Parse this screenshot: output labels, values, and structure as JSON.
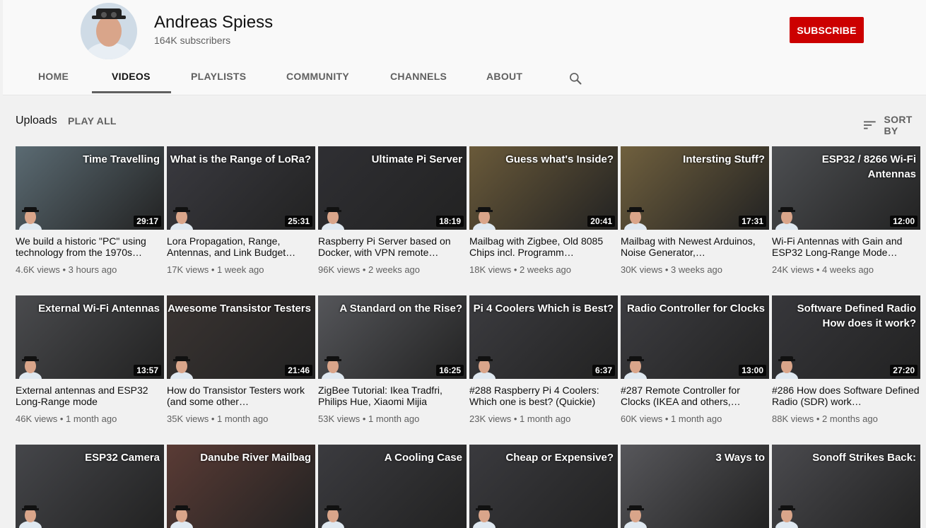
{
  "channel": {
    "name": "Andreas Spiess",
    "subscribers": "164K subscribers",
    "subscribe_label": "SUBSCRIBE"
  },
  "tabs": [
    {
      "label": "HOME"
    },
    {
      "label": "VIDEOS"
    },
    {
      "label": "PLAYLISTS"
    },
    {
      "label": "COMMUNITY"
    },
    {
      "label": "CHANNELS"
    },
    {
      "label": "ABOUT"
    }
  ],
  "section": {
    "uploads_label": "Uploads",
    "play_all_label": "PLAY ALL",
    "sort_by_label": "SORT BY"
  },
  "videos": [
    {
      "thumb_text": "Time Travelling",
      "duration": "29:17",
      "title": "We build a historic \"PC\" using technology from the 1970s…",
      "meta": "4.6K views • 3 hours ago",
      "bg": "#5b6b73"
    },
    {
      "thumb_text": "What is the Range of LoRa?",
      "duration": "25:31",
      "title": "Lora Propagation, Range, Antennas, and Link Budget…",
      "meta": "17K views • 1 week ago",
      "bg": "#3a3a40"
    },
    {
      "thumb_text": "Ultimate Pi Server",
      "duration": "18:19",
      "title": "Raspberry Pi Server based on Docker, with VPN remote…",
      "meta": "96K views • 2 weeks ago",
      "bg": "#2f2f33"
    },
    {
      "thumb_text": "Guess what's Inside?",
      "duration": "20:41",
      "title": "Mailbag with Zigbee, Old 8085 Chips incl. Programm…",
      "meta": "18K views • 2 weeks ago",
      "bg": "#6a5a3a"
    },
    {
      "thumb_text": "Intersting Stuff?",
      "duration": "17:31",
      "title": "Mailbag with Newest Arduinos, Noise Generator,…",
      "meta": "30K views • 3 weeks ago",
      "bg": "#70603e"
    },
    {
      "thumb_text": "ESP32 / 8266 Wi-Fi Antennas",
      "duration": "12:00",
      "title": "Wi-Fi Antennas with Gain and ESP32 Long-Range Mode…",
      "meta": "24K views • 4 weeks ago",
      "bg": "#4d4f52"
    },
    {
      "thumb_text": "External Wi-Fi Antennas",
      "duration": "13:57",
      "title": "External antennas and ESP32 Long-Range mode",
      "meta": "46K views • 1 month ago",
      "bg": "#4a4b4e"
    },
    {
      "thumb_text": "Awesome Transistor Testers",
      "duration": "21:46",
      "title": "How do Transistor Testers work (and some other…",
      "meta": "35K views • 1 month ago",
      "bg": "#3a3432"
    },
    {
      "thumb_text": "A Standard on the Rise?",
      "duration": "16:25",
      "title": "ZigBee Tutorial: Ikea Tradfri, Philips Hue, Xiaomi Mijia",
      "meta": "53K views • 1 month ago",
      "bg": "#55565a"
    },
    {
      "thumb_text": "Pi 4 Coolers Which is Best?",
      "duration": "6:37",
      "title": "#288 Raspberry Pi 4 Coolers: Which one is best? (Quickie)",
      "meta": "23K views • 1 month ago",
      "bg": "#3c3c40"
    },
    {
      "thumb_text": "Radio Controller for Clocks",
      "duration": "13:00",
      "title": "#287 Remote Controller for Clocks (IKEA and others,…",
      "meta": "60K views • 1 month ago",
      "bg": "#3d3d41"
    },
    {
      "thumb_text": "Software Defined Radio How does it work?",
      "duration": "27:20",
      "title": "#286 How does Software Defined Radio (SDR) work…",
      "meta": "88K views • 2 months ago",
      "bg": "#37373b"
    },
    {
      "thumb_text": "ESP32 Camera",
      "duration": "",
      "title": "",
      "meta": "",
      "bg": "#45464a"
    },
    {
      "thumb_text": "Danube River Mailbag",
      "duration": "",
      "title": "",
      "meta": "",
      "bg": "#5a3b35"
    },
    {
      "thumb_text": "A Cooling Case",
      "duration": "",
      "title": "",
      "meta": "",
      "bg": "#3b3b3f"
    },
    {
      "thumb_text": "Cheap or Expensive?",
      "duration": "",
      "title": "",
      "meta": "",
      "bg": "#3a3a3e"
    },
    {
      "thumb_text": "3 Ways to",
      "duration": "",
      "title": "",
      "meta": "",
      "bg": "#57575b"
    },
    {
      "thumb_text": "Sonoff Strikes Back:",
      "duration": "",
      "title": "",
      "meta": "",
      "bg": "#4a4a4e"
    }
  ]
}
